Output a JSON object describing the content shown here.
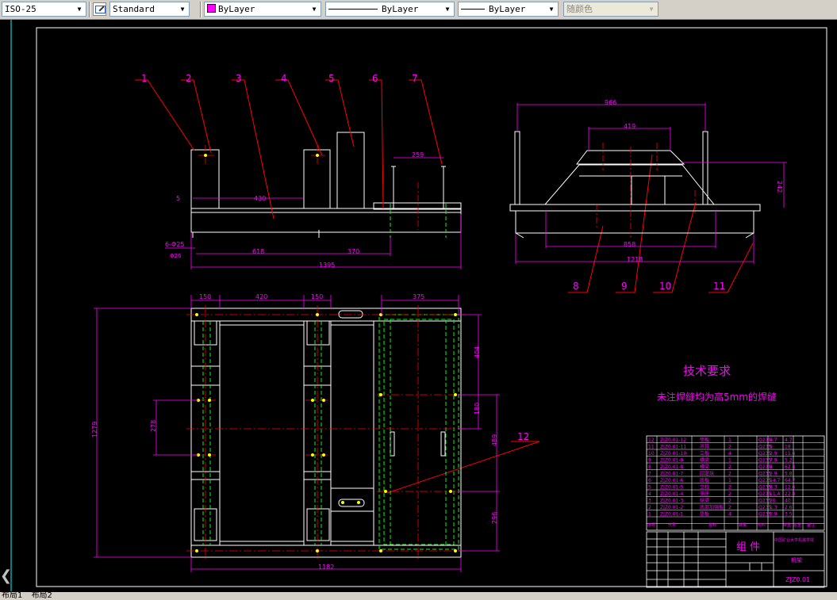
{
  "toolbar": {
    "dimstyle": "ISO-25",
    "tablestyle": "Standard",
    "color": "ByLayer",
    "linetype": "ByLayer",
    "lineweight": "ByLayer",
    "plotstyle": "随颜色"
  },
  "drawing": {
    "balloons_top": [
      "1",
      "2",
      "3",
      "4",
      "5",
      "6",
      "7"
    ],
    "balloons_side": [
      "8",
      "9",
      "10",
      "11"
    ],
    "balloon_plan": "12",
    "front_dims": [
      "5",
      "430",
      "259",
      "6-Φ25",
      "Φ26",
      "618",
      "370",
      "1395"
    ],
    "side_dims": [
      "966",
      "419",
      "242",
      "858",
      "1218"
    ],
    "plan_dims": [
      "150",
      "420",
      "150",
      "375",
      "1279",
      "278",
      "404",
      "180",
      "489",
      "296",
      "1182"
    ],
    "tech_title": "技术要求",
    "tech_note": "未注焊缝均为高5mm的焊缝",
    "bom_rows": [
      [
        "12",
        "ZJZ0.01-12",
        "垫板",
        "1",
        "Q235",
        "4.7",
        "4.7"
      ],
      [
        "11",
        "ZJZ0.01-11",
        "吊耳",
        "2",
        "Q235",
        "9",
        "18"
      ],
      [
        "10",
        "ZJZ0.01-10",
        "立板",
        "4",
        "Q235",
        "2.9",
        "11.6"
      ],
      [
        "9",
        "ZJZ0.01-9",
        "横梁",
        "1",
        "Q235",
        "7.9",
        "5.2"
      ],
      [
        "8",
        "ZJZ0.01-8",
        "横梁",
        "2",
        "Q235",
        "4",
        "62.8"
      ],
      [
        "7",
        "ZJZ0.01-7",
        "固定块",
        "2",
        "Q235",
        "2.9",
        "5.8"
      ],
      [
        "6",
        "ZJZ0.01-6",
        "底板",
        "1",
        "Q235",
        "54.7",
        "64.7"
      ],
      [
        "5",
        "ZJZ0.01-5",
        "立柱",
        "2",
        "Q235",
        "8.3",
        "12.6"
      ],
      [
        "4",
        "ZJZ0.01-4",
        "支座",
        "2",
        "Q235",
        "11.4",
        "22.8"
      ],
      [
        "3",
        "ZJZ0.01-3",
        "纵梁",
        "2",
        "Q235",
        "20",
        "40"
      ],
      [
        "2",
        "ZJZ0.01-2",
        "底部加强板",
        "2",
        "Q235",
        "1.3",
        "2.6"
      ],
      [
        "1",
        "ZJZ0.01-1",
        "垫板",
        "4",
        "Q235",
        "0.9",
        "3.5"
      ]
    ],
    "bom_header": [
      "序号",
      "代号",
      "名称",
      "数量",
      "材料",
      "单重",
      "总重",
      "备注"
    ],
    "title_block": {
      "name": "组  件",
      "school": "中国矿业大学机械学院",
      "material": "机架",
      "code": "ZJZ0.01"
    }
  },
  "tabs": [
    "布局1",
    "布局2"
  ]
}
